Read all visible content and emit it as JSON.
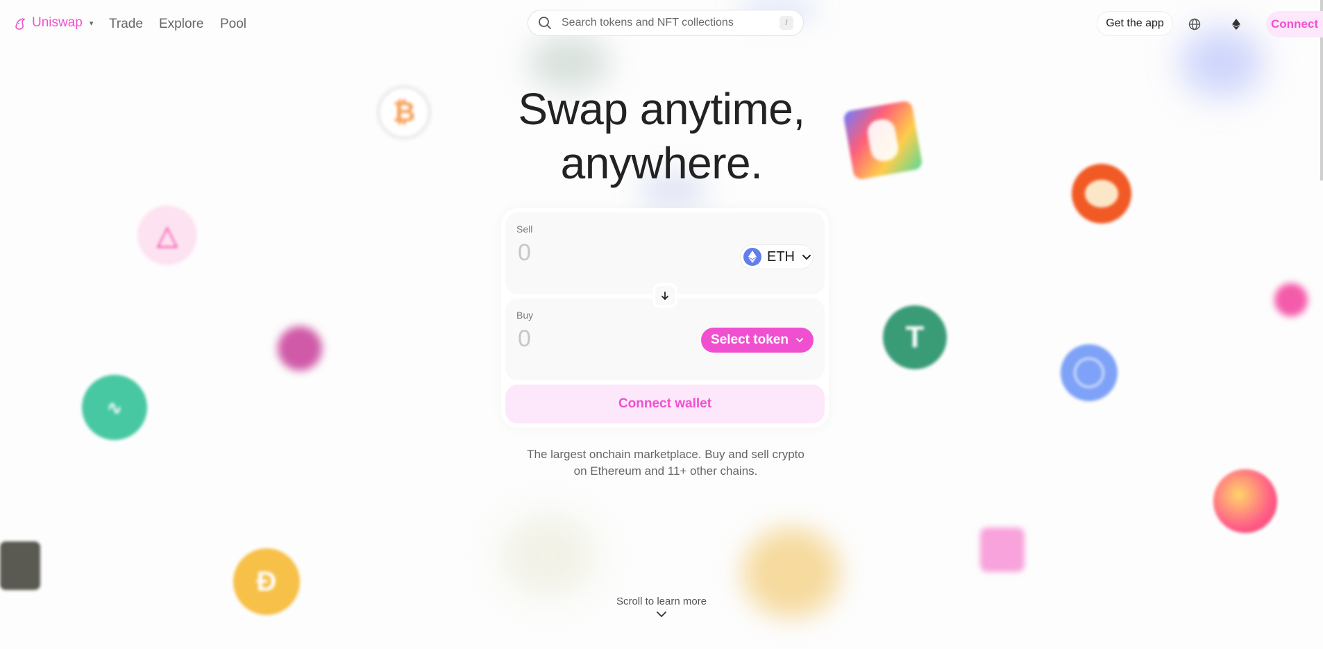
{
  "nav": {
    "logo_text": "Uniswap",
    "logo_caret": "▾",
    "links": [
      "Trade",
      "Explore",
      "Pool"
    ],
    "search_placeholder": "Search tokens and NFT collections",
    "search_shortcut": "/",
    "get_app_label": "Get the app",
    "connect_label": "Connect"
  },
  "hero": {
    "title_line1": "Swap anytime,",
    "title_line2": "anywhere."
  },
  "swap": {
    "sell_label": "Sell",
    "sell_amount_placeholder": "0",
    "sell_token": "ETH",
    "buy_label": "Buy",
    "buy_amount_placeholder": "0",
    "buy_token_label": "Select token",
    "connect_wallet_label": "Connect wallet"
  },
  "tagline_line1": "The largest onchain marketplace. Buy and sell crypto",
  "tagline_line2": "on Ethereum and 11+ other chains.",
  "scroll_label": "Scroll to learn more",
  "colors": {
    "accent": "#f050d0",
    "accent_soft": "#fde7fb",
    "eth": "#627eea"
  },
  "icons": [
    "uniswap-logo-icon",
    "search-icon",
    "globe-icon",
    "ethereum-icon",
    "chevron-down-icon",
    "arrow-down-icon"
  ]
}
